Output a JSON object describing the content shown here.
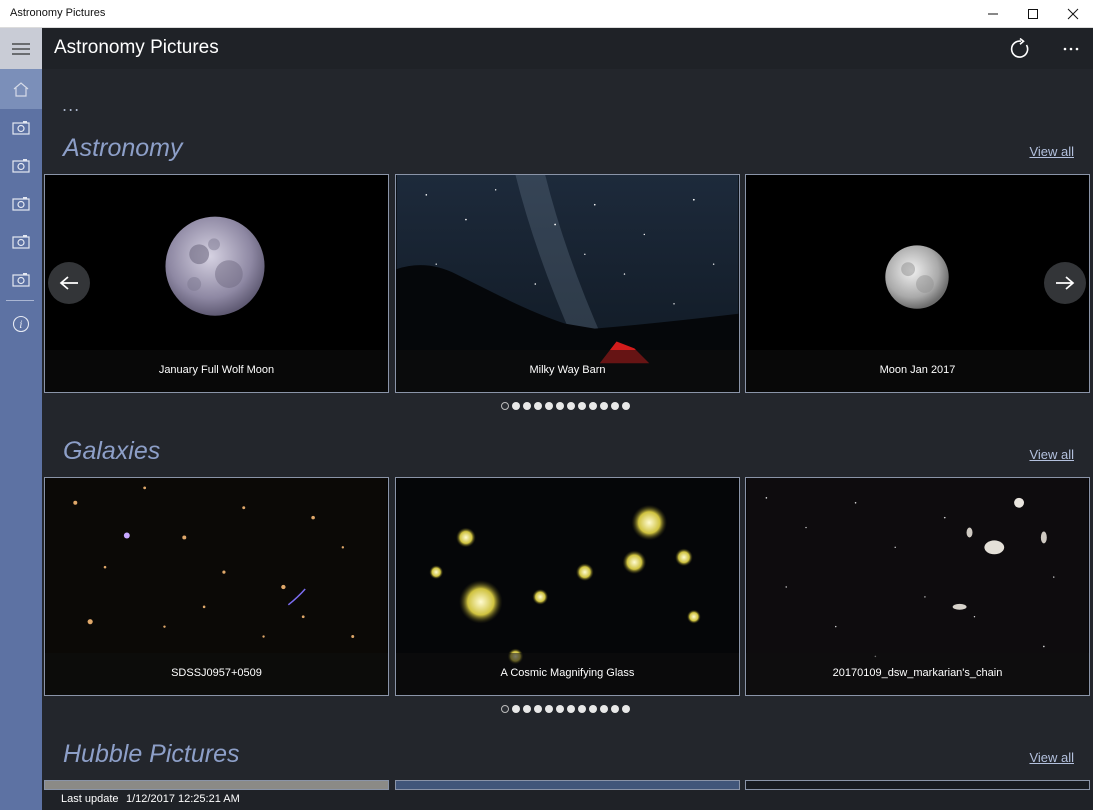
{
  "window": {
    "title": "Astronomy Pictures"
  },
  "header": {
    "title": "Astronomy Pictures"
  },
  "top_ellipsis": "...",
  "rail": {
    "icons": [
      "hamburger-icon",
      "home-icon",
      "camera-icon",
      "camera-icon",
      "camera-icon",
      "camera-icon",
      "camera-icon",
      "info-icon"
    ]
  },
  "sections": [
    {
      "title": "Astronomy",
      "view_all": "View all",
      "tiles": [
        {
          "caption": "January Full Wolf Moon"
        },
        {
          "caption": "Milky Way Barn"
        },
        {
          "caption": "Moon Jan 2017"
        }
      ],
      "dots_count": 12,
      "active_dot": 0
    },
    {
      "title": "Galaxies",
      "view_all": "View all",
      "tiles": [
        {
          "caption": "SDSSJ0957+0509"
        },
        {
          "caption": "A Cosmic Magnifying Glass"
        },
        {
          "caption": "20170109_dsw_markarian's_chain"
        }
      ],
      "dots_count": 12,
      "active_dot": 0
    },
    {
      "title": "Hubble Pictures",
      "view_all": "View all"
    }
  ],
  "status": {
    "label": "Last update",
    "value": "1/12/2017 12:25:21 AM"
  },
  "colors": {
    "rail": "#5d72a3",
    "accent_title": "#8d9fc8",
    "background": "#23262c"
  }
}
